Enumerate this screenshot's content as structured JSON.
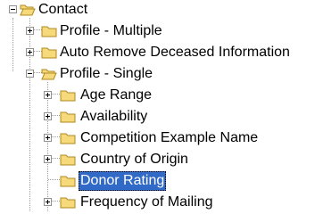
{
  "tree": {
    "root": {
      "label": "Contact",
      "icon": "open-folder-icon"
    },
    "items": [
      {
        "label": "Profile - Multiple",
        "icon": "folder-icon"
      },
      {
        "label": "Auto Remove Deceased Information",
        "icon": "folder-icon"
      },
      {
        "label": "Profile - Single",
        "icon": "open-folder-icon"
      }
    ],
    "children": [
      {
        "label": "Age Range",
        "icon": "folder-icon"
      },
      {
        "label": "Availability",
        "icon": "folder-icon"
      },
      {
        "label": "Competition Example Name",
        "icon": "folder-icon"
      },
      {
        "label": "Country of Origin",
        "icon": "folder-icon"
      },
      {
        "label": "Donor Rating",
        "icon": "folder-icon",
        "selected": true
      },
      {
        "label": "Frequency of Mailing",
        "icon": "folder-icon"
      }
    ]
  },
  "colors": {
    "selection": "#3169c6",
    "folder_fill": "#f6d97a",
    "folder_edge": "#b08a20",
    "lines": "#a0a0a0"
  }
}
